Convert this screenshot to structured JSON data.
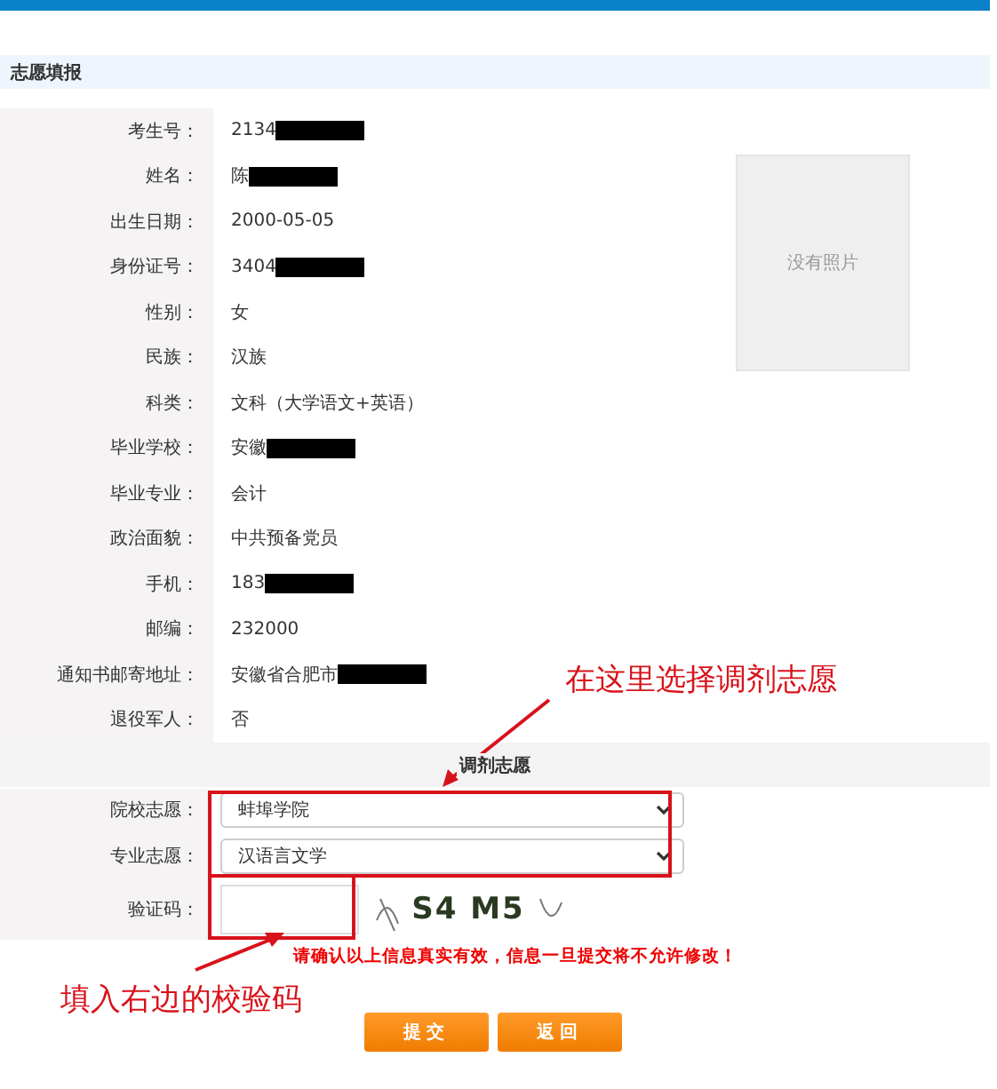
{
  "section_title": "志愿填报",
  "fields": [
    {
      "label": "考生号：",
      "value": "2134",
      "redacted": true
    },
    {
      "label": "姓名：",
      "value": "陈",
      "redacted": true
    },
    {
      "label": "出生日期：",
      "value": "2000-05-05",
      "redacted": false
    },
    {
      "label": "身份证号：",
      "value": "3404",
      "redacted": true
    },
    {
      "label": "性别：",
      "value": "女",
      "redacted": false
    },
    {
      "label": "民族：",
      "value": "汉族",
      "redacted": false
    },
    {
      "label": "科类：",
      "value": "文科（大学语文+英语）",
      "redacted": false
    },
    {
      "label": "毕业学校：",
      "value": "安徽",
      "redacted": true
    },
    {
      "label": "毕业专业：",
      "value": "会计",
      "redacted": false
    },
    {
      "label": "政治面貌：",
      "value": "中共预备党员",
      "redacted": false
    },
    {
      "label": "手机：",
      "value": "183",
      "redacted": true
    },
    {
      "label": "邮编：",
      "value": "232000",
      "redacted": false
    },
    {
      "label": "通知书邮寄地址：",
      "value": "安徽省合肥市",
      "redacted": true
    },
    {
      "label": "退役军人：",
      "value": "否",
      "redacted": false
    }
  ],
  "photo": {
    "text": "没有照片"
  },
  "adjust_header": "调剂志愿",
  "school_choice": {
    "label": "院校志愿：",
    "value": "蚌埠学院"
  },
  "major_choice": {
    "label": "专业志愿：",
    "value": "汉语言文学"
  },
  "captcha": {
    "label": "验证码：",
    "image_text": "S4 M5"
  },
  "warning": "请确认以上信息真实有效，信息一旦提交将不允许修改！",
  "buttons": [
    "提交",
    "返回"
  ],
  "annotations": [
    "在这里选择调剂志愿",
    "填入右边的校验码"
  ]
}
